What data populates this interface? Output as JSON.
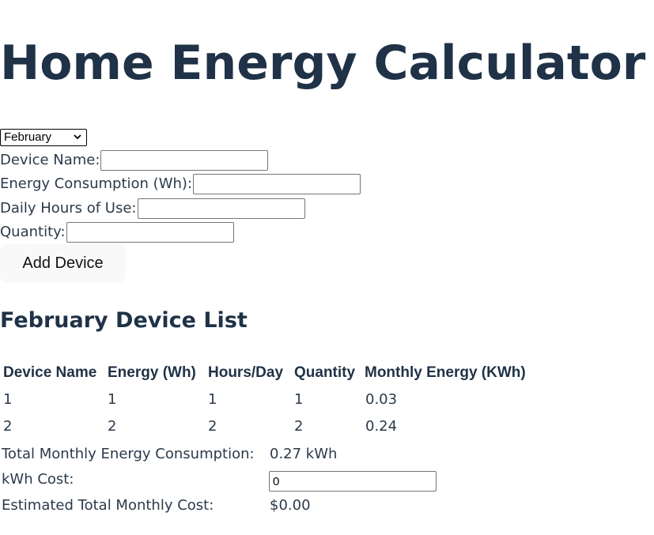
{
  "header": {
    "title": "Home Energy Calculator"
  },
  "month_select": {
    "selected": "February",
    "icon": "chevron-down-icon"
  },
  "form": {
    "device_name_label": "Device Name:",
    "device_name_value": "",
    "energy_label": "Energy Consumption (Wh):",
    "energy_value": "",
    "hours_label": "Daily Hours of Use:",
    "hours_value": "",
    "quantity_label": "Quantity:",
    "quantity_value": "",
    "add_button_label": "Add Device"
  },
  "device_list": {
    "title": "February Device List",
    "columns": [
      "Device Name",
      "Energy (Wh)",
      "Hours/Day",
      "Quantity",
      "Monthly Energy (KWh)"
    ],
    "rows": [
      [
        "1",
        "1",
        "1",
        "1",
        "0.03"
      ],
      [
        "2",
        "2",
        "2",
        "2",
        "0.24"
      ]
    ]
  },
  "summary": {
    "total_label": "Total Monthly Energy Consumption:",
    "total_value": "0.27 kWh",
    "cost_label": "kWh Cost:",
    "cost_value": "0",
    "estimated_label": "Estimated Total Monthly Cost:",
    "estimated_value": "$0.00"
  }
}
